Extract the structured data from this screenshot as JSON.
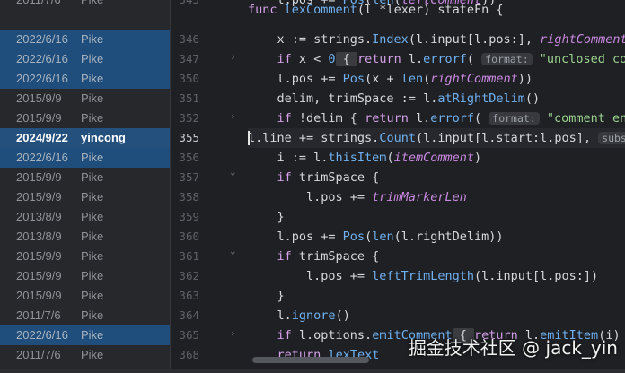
{
  "blame": [
    {
      "date": "2011/7/6",
      "author": "Pike",
      "state": "normal"
    },
    {
      "date": "2022/6/16",
      "author": "Pike",
      "state": "sel"
    },
    {
      "date": "2022/6/16",
      "author": "Pike",
      "state": "sel"
    },
    {
      "date": "2022/6/16",
      "author": "Pike",
      "state": "sel"
    },
    {
      "date": "2015/9/9",
      "author": "Pike",
      "state": "normal"
    },
    {
      "date": "2015/9/9",
      "author": "Pike",
      "state": "normal"
    },
    {
      "date": "2024/9/22",
      "author": "yincong",
      "state": "cur"
    },
    {
      "date": "2022/6/16",
      "author": "Pike",
      "state": "sel"
    },
    {
      "date": "2015/9/9",
      "author": "Pike",
      "state": "normal"
    },
    {
      "date": "2015/9/9",
      "author": "Pike",
      "state": "normal"
    },
    {
      "date": "2013/8/9",
      "author": "Pike",
      "state": "normal"
    },
    {
      "date": "2013/8/9",
      "author": "Pike",
      "state": "normal"
    },
    {
      "date": "2015/9/9",
      "author": "Pike",
      "state": "normal"
    },
    {
      "date": "2015/9/9",
      "author": "Pike",
      "state": "normal"
    },
    {
      "date": "2015/9/9",
      "author": "Pike",
      "state": "normal"
    },
    {
      "date": "2011/7/6",
      "author": "Pike",
      "state": "normal"
    },
    {
      "date": "2022/6/16",
      "author": "Pike",
      "state": "sel"
    },
    {
      "date": "2011/7/6",
      "author": "Pike",
      "state": "normal"
    }
  ],
  "line_numbers": [
    "345",
    "346",
    "347",
    "350",
    "351",
    "352",
    "355",
    "356",
    "357",
    "358",
    "359",
    "360",
    "361",
    "362",
    "363",
    "364",
    "365",
    "368"
  ],
  "current_line": "355",
  "code": {
    "t0a": "func ",
    "t0b": "lexComment",
    "t0c": "(l *",
    "t0d": "lexer",
    "t0e": ") stateFn {",
    "t1a": "    l.pos += ",
    "t1b": "Pos",
    "t1c": "(",
    "t1d": "len",
    "t1e": "(",
    "t1f": "leftComment",
    "t1g": "))",
    "t2a": "    x := strings.",
    "t2b": "Index",
    "t2c": "(l.input[l.pos:], ",
    "t2d": "rightComment",
    "t2e": ")",
    "t3a": "    ",
    "t3b": "if",
    "t3c": " x < ",
    "t3d": "0",
    "t3e": " { ",
    "t3f": "return",
    "t3g": " l.",
    "t3h": "errorf",
    "t3i": "( ",
    "t3j": "format:",
    "t3k": " \"unclosed comment\"",
    "t4a": "    l.pos += ",
    "t4b": "Pos",
    "t4c": "(x + ",
    "t4d": "len",
    "t4e": "(",
    "t4f": "rightComment",
    "t4g": "))",
    "t5a": "    delim, trimSpace := l.",
    "t5b": "atRightDelim",
    "t5c": "()",
    "t6a": "    ",
    "t6b": "if",
    "t6c": " !delim { ",
    "t6d": "return",
    "t6e": " l.",
    "t6f": "errorf",
    "t6g": "( ",
    "t6h": "format:",
    "t6i": " \"comment ends before\"",
    "t7a": "l.line += strings.",
    "t7b": "Count",
    "t7c": "(l.input[l.start:l.pos], ",
    "t7d": "substr:",
    "t8a": "    i := l.",
    "t8b": "thisItem",
    "t8c": "(",
    "t8d": "itemComment",
    "t8e": ")",
    "t9a": "    ",
    "t9b": "if",
    "t9c": " trimSpace {",
    "t10a": "        l.pos += ",
    "t10b": "trimMarkerLen",
    "t11a": "    }",
    "t12a": "    l.pos += ",
    "t12b": "Pos",
    "t12c": "(",
    "t12d": "len",
    "t12e": "(l.rightDelim))",
    "t13a": "    ",
    "t13b": "if",
    "t13c": " trimSpace {",
    "t14a": "        l.pos += ",
    "t14b": "leftTrimLength",
    "t14c": "(l.input[l.pos:])",
    "t15a": "    }",
    "t16a": "    l.",
    "t16b": "ignore",
    "t16c": "()",
    "t17a": "    ",
    "t17b": "if",
    "t17c": " l.options.",
    "t17d": "emitComment",
    "t17e": " { ",
    "t17f": "return",
    "t17g": " l.",
    "t17h": "emitItem",
    "t17i": "(i) }",
    "t18a": "    ",
    "t18b": "return",
    "t18c": " ",
    "t18d": "lexText"
  },
  "watermark": "掘金技术社区 @ jack_yin"
}
